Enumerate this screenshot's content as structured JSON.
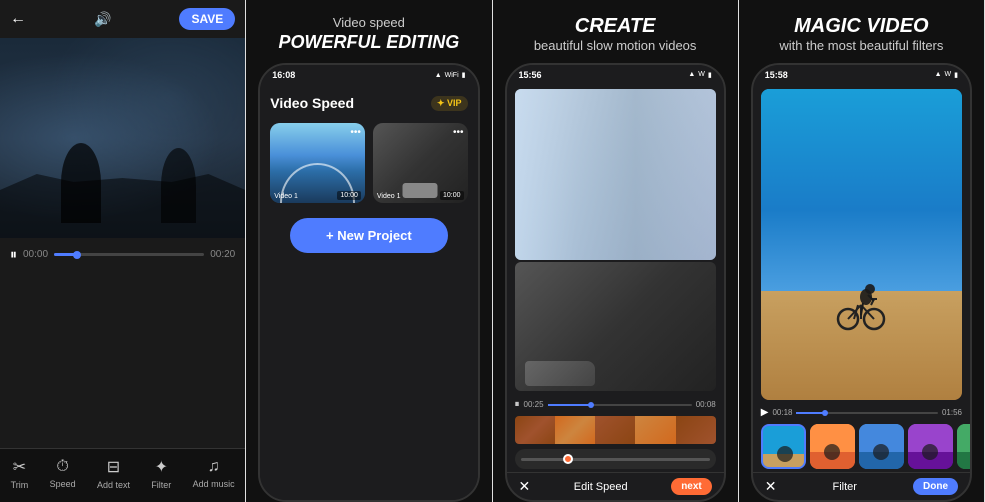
{
  "panel1": {
    "header": {
      "back_label": "←",
      "audio_label": "🔊",
      "save_label": "SAVE"
    },
    "controls": {
      "play_label": "⏸",
      "time_start": "00:00",
      "time_end": "00:20"
    },
    "toolbar": {
      "tools": [
        {
          "icon": "✂",
          "label": "Trim"
        },
        {
          "icon": "⏱",
          "label": "Speed"
        },
        {
          "icon": "⊟",
          "label": "Add text"
        },
        {
          "icon": "✦",
          "label": "Filter"
        },
        {
          "icon": "♫",
          "label": "Add music"
        }
      ]
    }
  },
  "panel2": {
    "subtitle": "Video speed",
    "title": "POWERFUL EDITING",
    "phone": {
      "time": "16:08",
      "header_title": "Video Speed",
      "vip_label": "✦ VIP",
      "thumb1_label": "Video 1",
      "thumb1_duration": "10:00",
      "thumb2_label": "Video 1",
      "thumb2_duration": "10:00",
      "new_project_label": "+ New Project"
    }
  },
  "panel3": {
    "title": "CREATE",
    "subtitle": "beautiful slow motion videos",
    "phone": {
      "time": "15:56",
      "controls": {
        "play_label": "⏸",
        "time_start": "00:25",
        "time_end": "00:08"
      },
      "bottom": {
        "close_label": "✕",
        "edit_label": "Edit Speed",
        "next_label": "next"
      }
    }
  },
  "panel4": {
    "title": "MAGIC VIDEO",
    "subtitle": "with the most beautiful filters",
    "phone": {
      "time": "15:58",
      "controls": {
        "play_label": "▶",
        "time_start": "00:18",
        "time_end": "01:56"
      },
      "bottom": {
        "close_label": "✕",
        "filter_label": "Filter",
        "done_label": "Done"
      }
    }
  }
}
